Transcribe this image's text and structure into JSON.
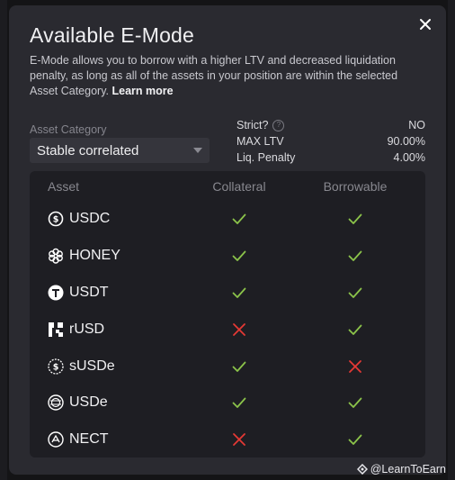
{
  "dialog": {
    "title": "Available E-Mode",
    "description": "E-Mode allows you to borrow with a higher LTV and decreased liquidation penalty, as long as all of the assets in your position are within the selected Asset Category.",
    "learn_more": "Learn more",
    "close_icon": "close-icon"
  },
  "category": {
    "label": "Asset Category",
    "selected": "Stable correlated"
  },
  "stats": {
    "strict_label": "Strict?",
    "strict_value": "NO",
    "max_ltv_label": "MAX LTV",
    "max_ltv_value": "90.00%",
    "liq_penalty_label": "Liq. Penalty",
    "liq_penalty_value": "4.00%"
  },
  "table": {
    "headers": {
      "asset": "Asset",
      "collateral": "Collateral",
      "borrowable": "Borrowable"
    },
    "rows": [
      {
        "asset": "USDC",
        "icon": "usdc-icon",
        "collateral": true,
        "borrowable": true
      },
      {
        "asset": "HONEY",
        "icon": "honey-icon",
        "collateral": true,
        "borrowable": true
      },
      {
        "asset": "USDT",
        "icon": "usdt-icon",
        "collateral": true,
        "borrowable": true
      },
      {
        "asset": "rUSD",
        "icon": "rusd-icon",
        "collateral": false,
        "borrowable": true
      },
      {
        "asset": "sUSDe",
        "icon": "susde-icon",
        "collateral": true,
        "borrowable": false
      },
      {
        "asset": "USDe",
        "icon": "usde-icon",
        "collateral": true,
        "borrowable": true
      },
      {
        "asset": "NECT",
        "icon": "nect-icon",
        "collateral": false,
        "borrowable": true
      }
    ]
  },
  "watermark": "@LearnToEarn",
  "colors": {
    "check": "#8bc34a",
    "cross": "#e53935",
    "modal_bg": "#2a2a30",
    "table_bg": "#1e1e23"
  }
}
